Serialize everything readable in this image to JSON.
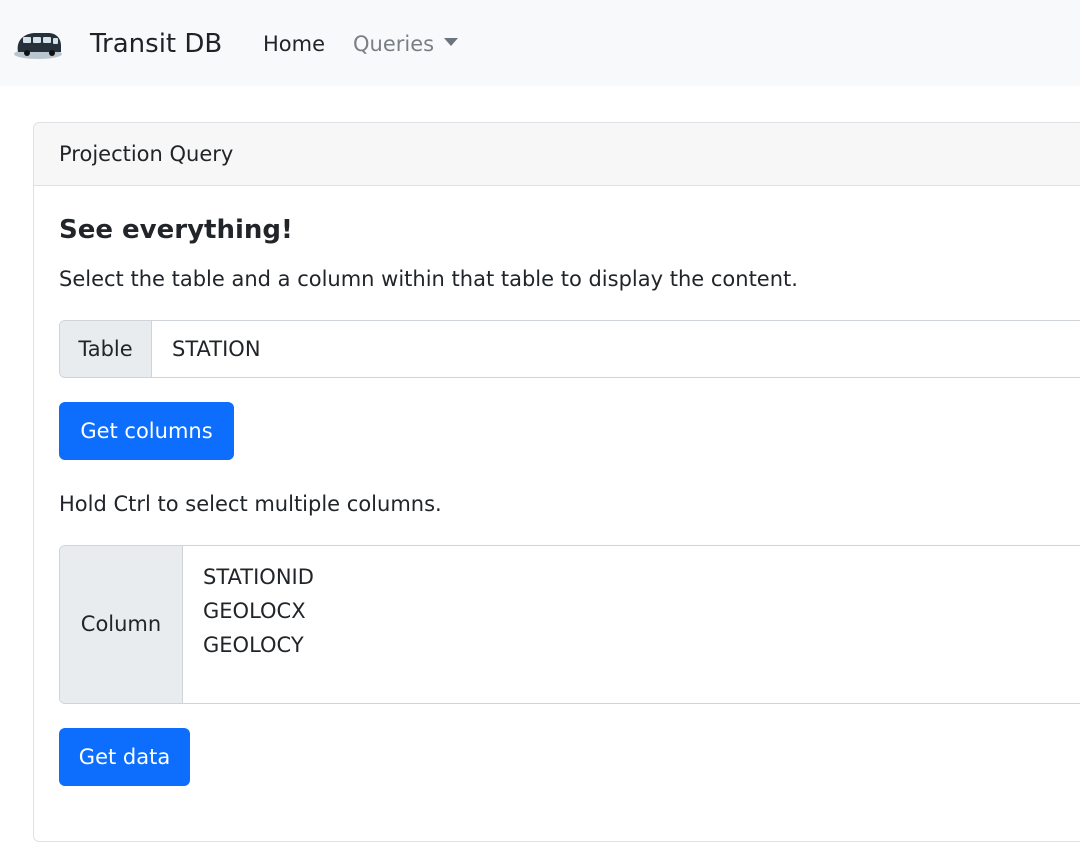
{
  "navbar": {
    "logo_icon": "bus-icon",
    "brand": "Transit DB",
    "links": {
      "home": "Home",
      "queries": "Queries"
    }
  },
  "card": {
    "header": "Projection Query",
    "title": "See everything!",
    "description": "Select the table and a column within that table to display the content.",
    "table_select": {
      "label": "Table",
      "value": "STATION"
    },
    "get_columns_button": "Get columns",
    "hint": "Hold Ctrl to select multiple columns.",
    "column_select": {
      "label": "Column",
      "options": [
        "STATIONID",
        "GEOLOCX",
        "GEOLOCY"
      ]
    },
    "get_data_button": "Get data"
  },
  "colors": {
    "primary": "#0d6efd",
    "navbar_bg": "#f8f9fa",
    "muted_link": "#6c757d"
  }
}
